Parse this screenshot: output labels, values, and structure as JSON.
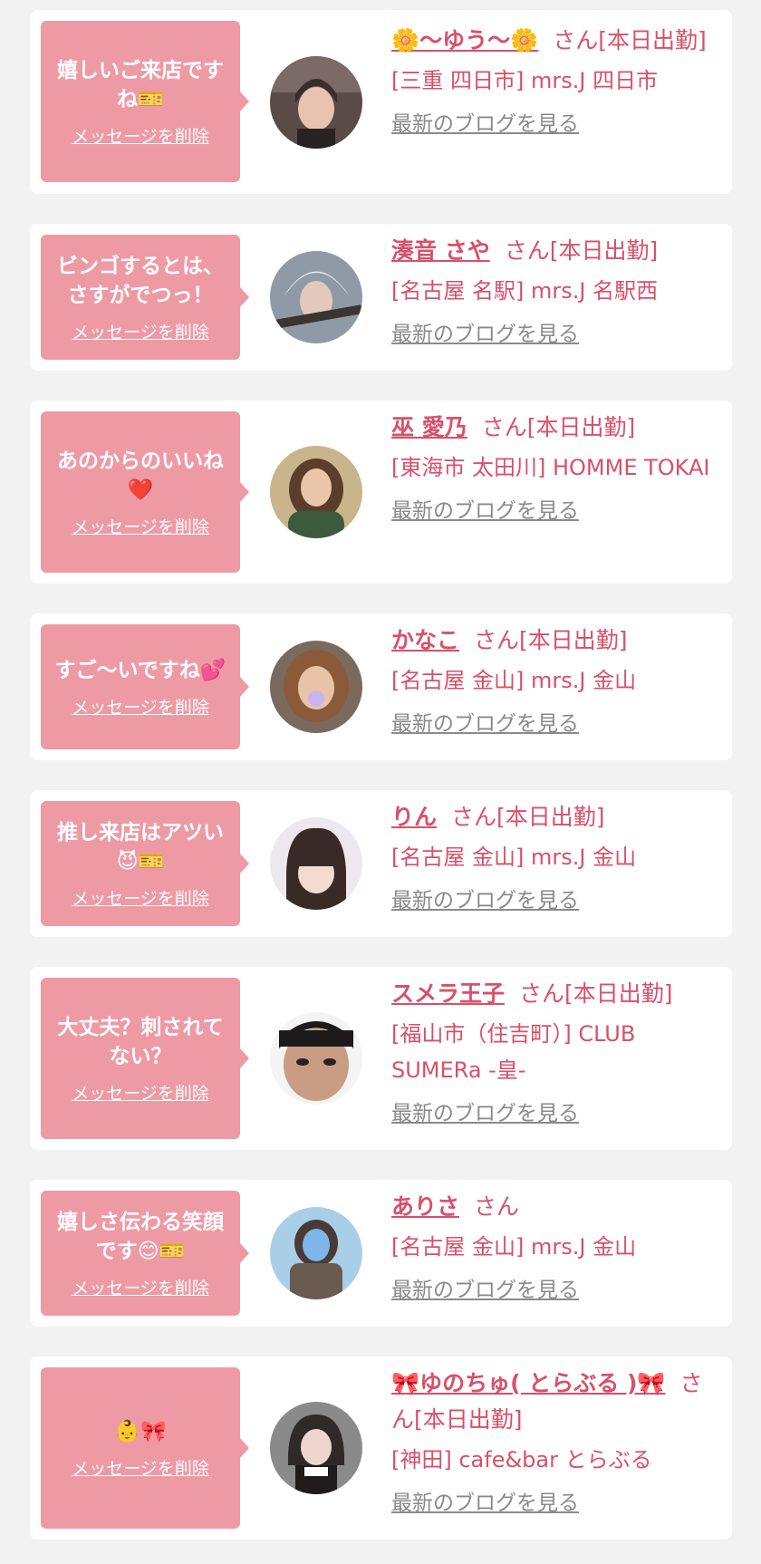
{
  "delete_label": "メッセージを削除",
  "blog_label": "最新のブログを見る",
  "colors": {
    "accent": "#d8506a",
    "bubble": "#ee9aa5",
    "background": "#f2f2f2",
    "link_gray": "#8a8a8a"
  },
  "cards": [
    {
      "message": "嬉しいご来店ですね",
      "message_emoji": "🎫",
      "name": "🌼〜ゆう〜🌼",
      "suffix": "さん[本日出勤]",
      "shop": "[三重 四日市] mrs.J 四日市"
    },
    {
      "message": "ビンゴするとは、さすがでつっ！",
      "message_emoji": "",
      "name": "湊音 さや",
      "suffix": "さん[本日出勤]",
      "shop": "[名古屋 名駅] mrs.J 名駅西"
    },
    {
      "message": "あのからのいいね",
      "message_emoji": "❤️",
      "name": "巫 愛乃",
      "suffix": "さん[本日出勤]",
      "shop": "[東海市 太田川] HOMME TOKAI"
    },
    {
      "message": "すご〜いですね",
      "message_emoji": "💕",
      "name": "かなこ",
      "suffix": "さん[本日出勤]",
      "shop": "[名古屋 金山] mrs.J 金山"
    },
    {
      "message": "推し来店はアツい",
      "message_emoji": "😈🎫",
      "name": "りん",
      "suffix": "さん[本日出勤]",
      "shop": "[名古屋 金山] mrs.J 金山"
    },
    {
      "message": "大丈夫？刺されてない？",
      "message_emoji": "",
      "name": "スメラ王子",
      "suffix": "さん[本日出勤]",
      "shop": "[福山市（住吉町）] CLUB SUMERa -皇-"
    },
    {
      "message": "嬉しさ伝わる笑顔です",
      "message_emoji": "😊🎫",
      "name": "ありさ",
      "suffix": "さん",
      "shop": "[名古屋 金山] mrs.J 金山"
    },
    {
      "message": "",
      "message_emoji": "👶🎀",
      "name": "🎀ゆのちゅ( とらぶる )🎀",
      "suffix": "さん[本日出勤]",
      "shop": "[神田] cafe&bar とらぶる"
    }
  ]
}
